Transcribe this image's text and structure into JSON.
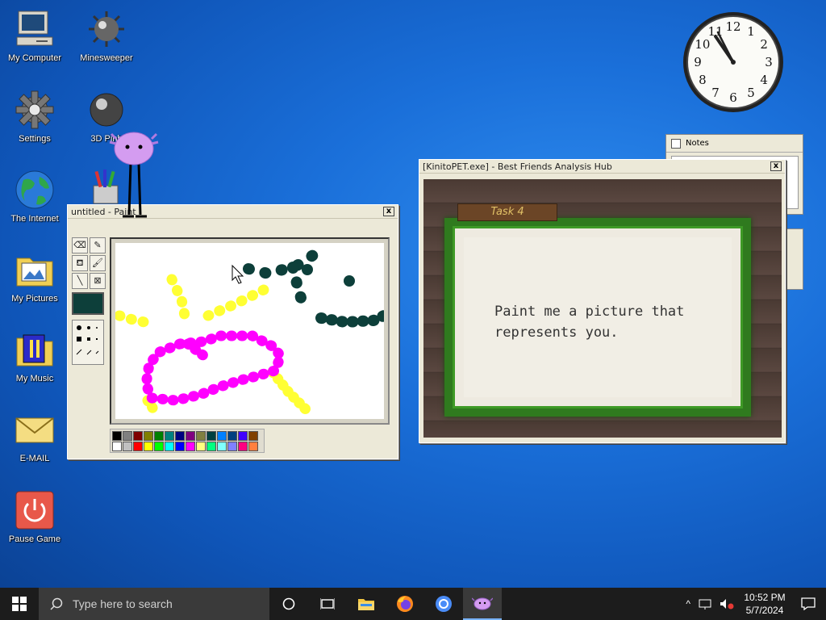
{
  "desktop_icons": [
    {
      "label": "My Computer",
      "icon": "computer-icon"
    },
    {
      "label": "Minesweeper",
      "icon": "mine-icon"
    },
    {
      "label": "Settings",
      "icon": "gear-icon"
    },
    {
      "label": "3D Pinb",
      "icon": "pinball-icon"
    },
    {
      "label": "The Internet",
      "icon": "globe-icon"
    },
    {
      "label": "My Pictures",
      "icon": "pictures-folder-icon"
    },
    {
      "label": "My Music",
      "icon": "music-folder-icon"
    },
    {
      "label": "E-MAIL",
      "icon": "envelope-icon"
    },
    {
      "label": "Pause Game",
      "icon": "power-icon"
    }
  ],
  "paint_window": {
    "title": "untitled - Paint",
    "close": "x",
    "tools": [
      "eraser",
      "pencil",
      "fill",
      "brush",
      "line",
      "select"
    ],
    "current_color": "#0d3f3a",
    "palette_row1": [
      "#000000",
      "#808080",
      "#800000",
      "#808000",
      "#008000",
      "#008080",
      "#000080",
      "#800080",
      "#808040",
      "#004040",
      "#0080ff",
      "#004080",
      "#4000ff",
      "#804000"
    ],
    "palette_row2": [
      "#ffffff",
      "#c0c0c0",
      "#ff0000",
      "#ffff00",
      "#00ff00",
      "#00ffff",
      "#0000ff",
      "#ff00ff",
      "#ffff80",
      "#00ff80",
      "#80ffff",
      "#8080ff",
      "#ff0080",
      "#ff8040"
    ]
  },
  "kinito_window": {
    "title": "[KinitoPET.exe] - Best Friends Analysis Hub",
    "close": "x",
    "task_label": "Task 4",
    "task_text_line1": "Paint me a picture that",
    "task_text_line2": "represents you."
  },
  "notes_window": {
    "title": "Notes"
  },
  "analog_clock": {
    "numbers": [
      "12",
      "1",
      "2",
      "3",
      "4",
      "5",
      "6",
      "7",
      "8",
      "9",
      "10",
      "11"
    ]
  },
  "taskbar": {
    "search_placeholder": "Type here to search",
    "time": "10:52 PM",
    "date": "5/7/2024"
  }
}
